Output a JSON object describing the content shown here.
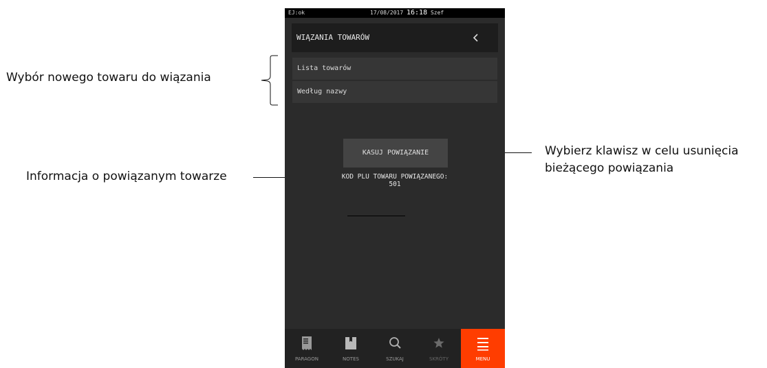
{
  "annotations": {
    "left_top": "Wybór nowego towaru do wiązania",
    "left_bottom": "Informacja o powiązanym towarze",
    "right_line1": "Wybierz klawisz w celu usunięcia",
    "right_line2": "bieżącego powiązania"
  },
  "statusbar": {
    "ej_status": "EJ:ok",
    "date": "17/08/2017",
    "time": "16:18",
    "user": "Szef"
  },
  "header": {
    "title": "WIĄZANIA TOWARÓW"
  },
  "menu": {
    "items": [
      {
        "label": "Lista towarów"
      },
      {
        "label": "Według nazwy"
      }
    ]
  },
  "actions": {
    "delete_label": "KASUJ POWIĄZANIE"
  },
  "info": {
    "label": "KOD PLU TOWARU POWIĄZANEGO:",
    "value": "501"
  },
  "bottom_nav": {
    "tabs": [
      {
        "label": "PARAGON",
        "icon": "receipt-icon"
      },
      {
        "label": "NOTES",
        "icon": "notebook-icon"
      },
      {
        "label": "SZUKAJ",
        "icon": "search-icon"
      },
      {
        "label": "SKRÓTY",
        "icon": "star-icon"
      },
      {
        "label": "MENU",
        "icon": "menu-icon"
      }
    ],
    "active_color": "#ff3d00"
  }
}
